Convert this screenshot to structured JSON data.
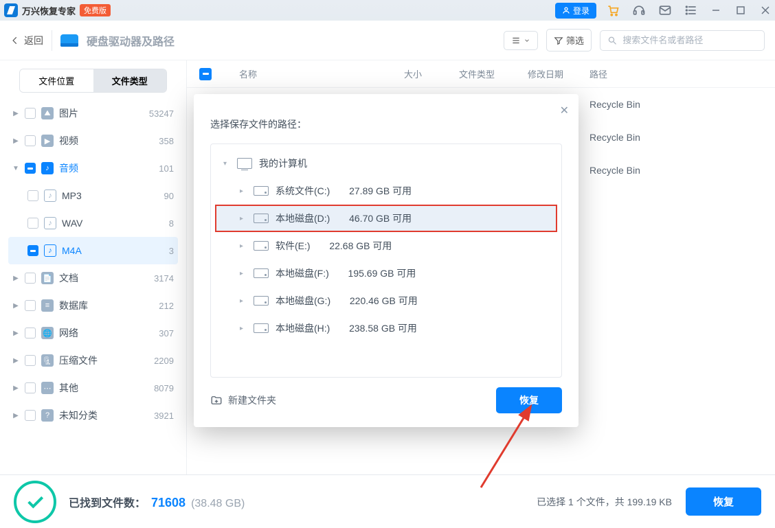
{
  "titlebar": {
    "app_name": "万兴恢复专家",
    "free_badge": "免费版",
    "login": "登录"
  },
  "header": {
    "back": "返回",
    "location": "硬盘驱动器及路径",
    "filter": "筛选",
    "search_placeholder": "搜索文件名或者路径"
  },
  "sidebar": {
    "tab_location": "文件位置",
    "tab_type": "文件类型",
    "categories": [
      {
        "name": "图片",
        "count": "53247"
      },
      {
        "name": "视频",
        "count": "358"
      },
      {
        "name": "音频",
        "count": "101"
      },
      {
        "name": "文档",
        "count": "3174"
      },
      {
        "name": "数据库",
        "count": "212"
      },
      {
        "name": "网络",
        "count": "307"
      },
      {
        "name": "压缩文件",
        "count": "2209"
      },
      {
        "name": "其他",
        "count": "8079"
      },
      {
        "name": "未知分类",
        "count": "3921"
      }
    ],
    "audio_sub": [
      {
        "name": "MP3",
        "count": "90"
      },
      {
        "name": "WAV",
        "count": "8"
      },
      {
        "name": "M4A",
        "count": "3"
      }
    ]
  },
  "table": {
    "headers": {
      "name": "名称",
      "size": "大小",
      "type": "文件类型",
      "date": "修改日期",
      "path": "路径"
    },
    "rows": [
      {
        "name": "",
        "path": "Recycle Bin"
      },
      {
        "name": "",
        "path": "Recycle Bin"
      },
      {
        "name": "",
        "path": "Recycle Bin"
      }
    ]
  },
  "status": {
    "found_label": "已找到文件数：",
    "found_count": "71608",
    "found_size": "(38.48 GB)",
    "selected_info": "已选择 1 个文件，共 199.19 KB",
    "recover": "恢复"
  },
  "modal": {
    "title": "选择保存文件的路径：",
    "root": "我的计算机",
    "drives": [
      {
        "label": "系统文件(C:)",
        "free": "27.89 GB 可用"
      },
      {
        "label": "本地磁盘(D:)",
        "free": "46.70 GB 可用"
      },
      {
        "label": "软件(E:)",
        "free": "22.68 GB 可用"
      },
      {
        "label": "本地磁盘(F:)",
        "free": "195.69 GB 可用"
      },
      {
        "label": "本地磁盘(G:)",
        "free": "220.46 GB 可用"
      },
      {
        "label": "本地磁盘(H:)",
        "free": "238.58 GB 可用"
      }
    ],
    "new_folder": "新建文件夹",
    "recover": "恢复"
  }
}
